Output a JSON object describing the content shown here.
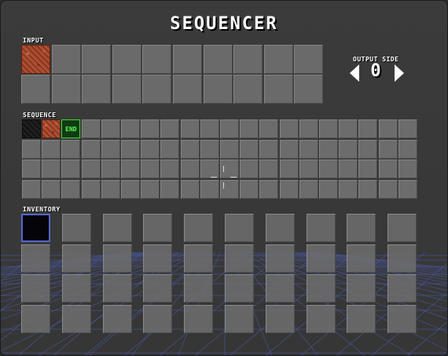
{
  "title": "SEQUENCER",
  "input": {
    "label": "INPUT",
    "rows": 2,
    "cols": 10,
    "slots": [
      {
        "index": 0,
        "item": "dirt-block"
      }
    ]
  },
  "output_side": {
    "label": "OUTPUT SIDE",
    "value": "0",
    "prev_icon": "arrow-left-icon",
    "next_icon": "arrow-right-icon"
  },
  "sequence": {
    "label": "SEQUENCE",
    "rows": 4,
    "cols": 20,
    "slots": [
      {
        "index": 0,
        "item": "dark-block"
      },
      {
        "index": 1,
        "item": "dirt-block"
      },
      {
        "index": 2,
        "item": "end-marker",
        "text": "END"
      }
    ]
  },
  "inventory": {
    "label": "INVENTORY",
    "rows": 4,
    "cols": 10,
    "selected_index": 0,
    "selected_color": "#5566cc"
  },
  "colors": {
    "end_border": "#33dd33",
    "grid_lines": "#4455aa"
  }
}
